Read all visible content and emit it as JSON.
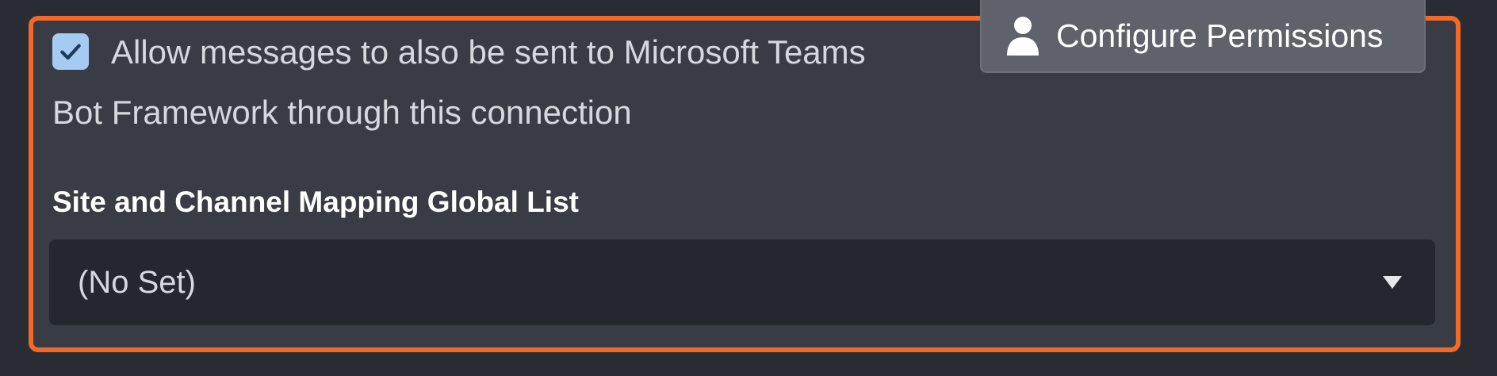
{
  "permissions_button": {
    "label": "Configure Permissions",
    "icon": "person-icon"
  },
  "teams_option": {
    "checked": true,
    "label_line1": "Allow messages to also be sent to Microsoft Teams",
    "label_line2": "Bot Framework through this connection"
  },
  "mapping": {
    "title": "Site and Channel Mapping Global List",
    "selected": "(No Set)",
    "icon": "chevron-down-icon"
  },
  "colors": {
    "highlight_border": "#f26a2a",
    "checkbox_fill": "#a6cbf3"
  }
}
